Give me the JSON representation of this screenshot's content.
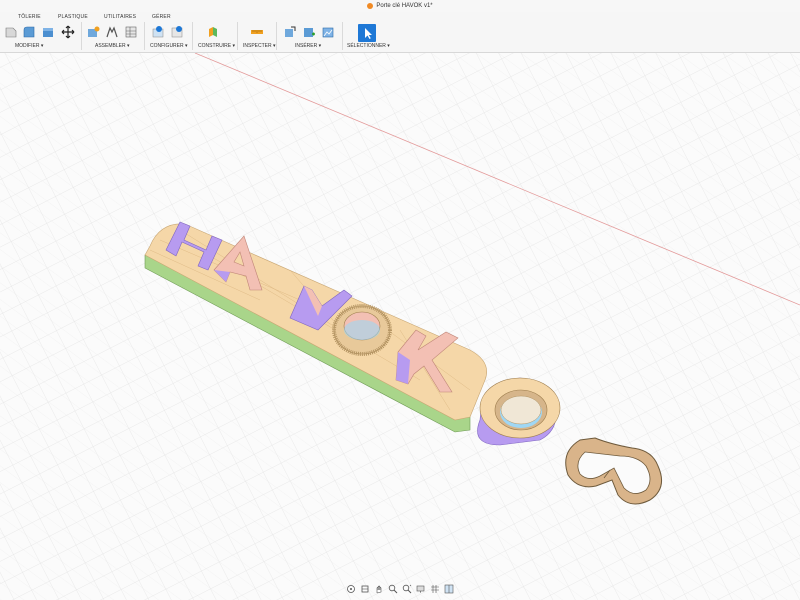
{
  "window": {
    "title": "Porte clé HAVOK v1*"
  },
  "toolbar": {
    "tabs": [
      "TÔLERIE",
      "PLASTIQUE",
      "UTILITAIRES",
      "GÉRER"
    ],
    "groups": [
      "MODIFIER ▾",
      "ASSEMBLER ▾",
      "CONFIGURER ▾",
      "CONSTRUIRE ▾",
      "INSPECTER ▾",
      "INSÉRER ▾",
      "SÉLECTIONNER ▾"
    ]
  },
  "model": {
    "text": "HAVOK",
    "colors": {
      "top_face": "#f5d7a8",
      "side_green": "#a9d58a",
      "letter_purple": "#b79bf0",
      "letter_pink": "#f3c0b4",
      "ring_cyan": "#9fd7f4",
      "grid": "#e4e4e4",
      "axis_red": "#e08080"
    }
  },
  "navbar": {
    "icons": [
      "orbit-icon",
      "look-at-icon",
      "pan-icon",
      "zoom-icon",
      "zoom-window-icon",
      "display-settings-icon",
      "grid-settings-icon",
      "viewports-icon"
    ]
  }
}
